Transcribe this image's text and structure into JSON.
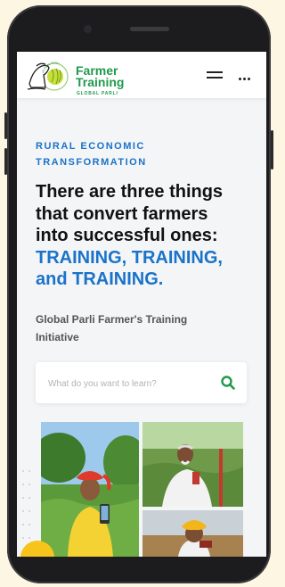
{
  "header": {
    "logo": {
      "title_line1": "Farmer",
      "title_line2": "Training",
      "subtitle": "GLOBAL PARLI",
      "ring_text": "GLOBAL PARLI"
    },
    "menu_icon": "hamburger-menu-icon",
    "more_icon": "more-options-icon"
  },
  "hero": {
    "eyebrow_line1": "RURAL ECONOMIC",
    "eyebrow_line2": "TRANSFORMATION",
    "headline_line1": "There are three things",
    "headline_line2": "that convert farmers",
    "headline_line3": "into successful ones:",
    "headline_highlight_line1": "TRAINING, TRAINING,",
    "headline_highlight_line2": "and TRAINING.",
    "subtitle_line1": "Global Parli Farmer's Training",
    "subtitle_line2": "Initiative"
  },
  "search": {
    "placeholder": "What do you want to learn?",
    "value": "",
    "icon": "search-icon"
  },
  "gallery": {
    "photos": [
      "farmer-with-phone-photo",
      "elderly-farmer-on-phone-photo",
      "farmer-yellow-turban-photo"
    ]
  },
  "colors": {
    "accent_blue": "#1a73c9",
    "brand_green": "#1f9a4b",
    "fab_yellow": "#f7c41c",
    "background": "#f4f5f6"
  }
}
